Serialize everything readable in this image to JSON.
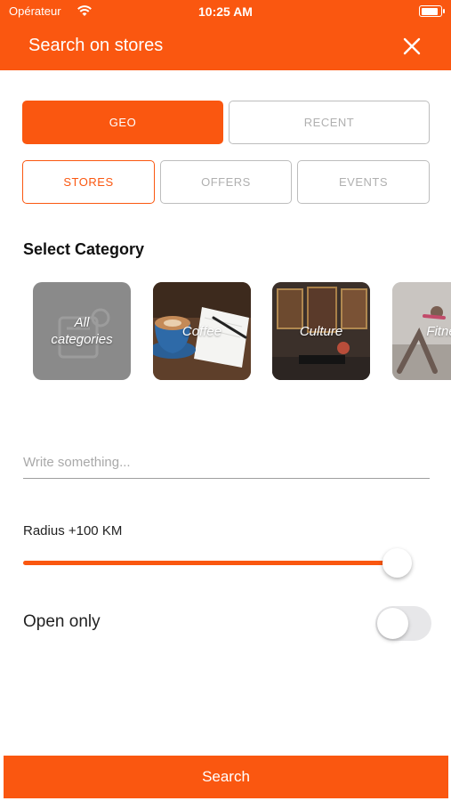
{
  "status_bar": {
    "carrier": "Opérateur",
    "time": "10:25 AM"
  },
  "header": {
    "title": "Search on stores",
    "close_icon": "close-icon"
  },
  "mode_tabs": [
    {
      "label": "GEO",
      "selected": true
    },
    {
      "label": "RECENT",
      "selected": false
    }
  ],
  "type_tabs": [
    {
      "label": "STORES",
      "selected": true
    },
    {
      "label": "OFFERS",
      "selected": false
    },
    {
      "label": "EVENTS",
      "selected": false
    }
  ],
  "category": {
    "title": "Select Category",
    "items": [
      {
        "label": "All\ncategories"
      },
      {
        "label": "Coffee"
      },
      {
        "label": "Culture"
      },
      {
        "label": "Fitne"
      }
    ]
  },
  "search": {
    "placeholder": "Write something...",
    "value": ""
  },
  "radius": {
    "label": "Radius +100 KM",
    "slider_fraction": 0.955
  },
  "open_only": {
    "label": "Open only",
    "enabled": false
  },
  "action": {
    "label": "Search"
  },
  "colors": {
    "accent": "#fa5710",
    "outline": "#bdbdbd",
    "muted_text": "#b0b0b0"
  }
}
